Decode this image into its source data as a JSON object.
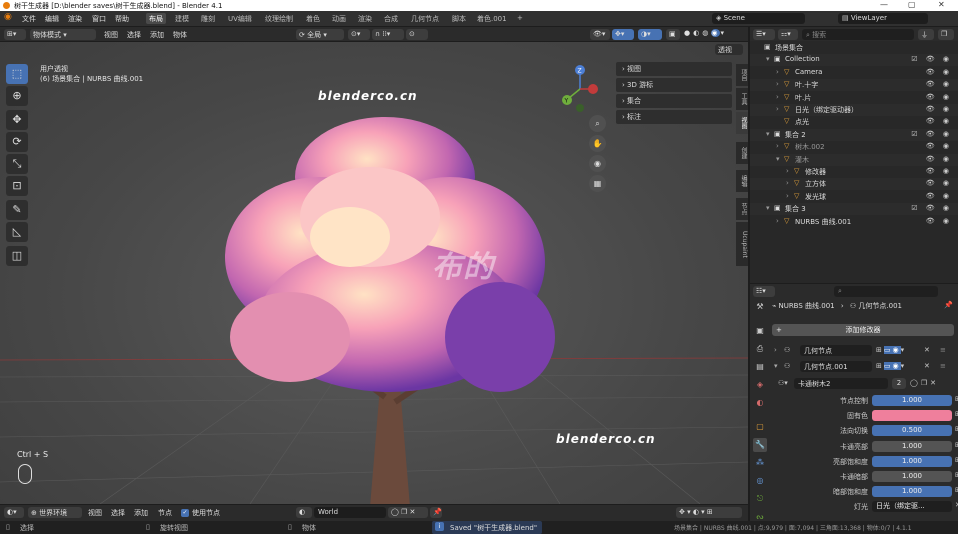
{
  "titlebar": {
    "title": "树干生成器 [D:\\blender saves\\树干生成器.blend] - Blender 4.1"
  },
  "menu": [
    "文件",
    "编辑",
    "渲染",
    "窗口",
    "帮助"
  ],
  "workspaces": [
    "布局",
    "建模",
    "雕刻",
    "UV编辑",
    "纹理绘制",
    "着色",
    "动画",
    "渲染",
    "合成",
    "几何节点",
    "脚本",
    "着色.001"
  ],
  "active_workspace": "布局",
  "scene": {
    "label": "Scene",
    "view_layer": "ViewLayer"
  },
  "viewport_header": {
    "mode": "物体模式",
    "menus": [
      "视图",
      "选择",
      "添加",
      "物体"
    ],
    "transform": "全局",
    "xray_label": "透视"
  },
  "viewport": {
    "overlay_text_1": "用户透视",
    "overlay_text_2": "(6) 场景集合 | NURBS 曲线.001",
    "watermark_1": "blenderco.cn",
    "watermark_2": "blenderco.cn",
    "watermark_3": "布的",
    "shortcut": "Ctrl + S",
    "npanels": [
      "视图",
      "3D 游标",
      "集合",
      "标注"
    ],
    "side_tabs": [
      "项目",
      "工具",
      "视图",
      "创建",
      "编辑",
      "节点",
      "Ucupaint"
    ]
  },
  "outliner": {
    "search_placeholder": "搜索",
    "rows": [
      {
        "label": "场景集合",
        "indent": 0,
        "tri": ""
      },
      {
        "label": "Collection",
        "indent": 1,
        "tri": "▾"
      },
      {
        "label": "Camera",
        "indent": 2,
        "tri": "›"
      },
      {
        "label": "叶.十字",
        "indent": 2,
        "tri": "›"
      },
      {
        "label": "叶.片",
        "indent": 2,
        "tri": "›"
      },
      {
        "label": "日光（绑定驱动器）",
        "indent": 2,
        "tri": "›"
      },
      {
        "label": "点光",
        "indent": 2,
        "tri": ""
      },
      {
        "label": "集合 2",
        "indent": 1,
        "tri": "▾"
      },
      {
        "label": "树木.002",
        "indent": 2,
        "tri": "›"
      },
      {
        "label": "灌木",
        "indent": 2,
        "tri": "▾"
      },
      {
        "label": "修改器",
        "indent": 3,
        "tri": "›"
      },
      {
        "label": "立方体",
        "indent": 3,
        "tri": "›"
      },
      {
        "label": "发光球",
        "indent": 3,
        "tri": "›"
      },
      {
        "label": "集合 3",
        "indent": 1,
        "tri": "▾"
      },
      {
        "label": "NURBS 曲线.001",
        "indent": 2,
        "tri": "›"
      }
    ]
  },
  "properties": {
    "breadcrumb_obj": "NURBS 曲线.001",
    "breadcrumb_mod": "几何节点.001",
    "add_modifier": "添加修改器",
    "modifiers": [
      "几何节点",
      "几何节点.001"
    ],
    "node_group": "卡通树木2",
    "node_group_users": "2",
    "params": [
      {
        "label": "节点控制",
        "value": "1.000",
        "style": "blue"
      },
      {
        "label": "固有色",
        "value": "",
        "style": "pink"
      },
      {
        "label": "法向切换",
        "value": "0.500",
        "style": "blue"
      },
      {
        "label": "卡通亮部",
        "value": "1.000",
        "style": "gray"
      },
      {
        "label": "亮部饱和度",
        "value": "1.000",
        "style": "blue"
      },
      {
        "label": "卡通暗部",
        "value": "1.000",
        "style": "gray"
      },
      {
        "label": "暗部饱和度",
        "value": "1.000",
        "style": "blue"
      },
      {
        "label": "灯光",
        "value": "日光（绑定驱...",
        "style": "field"
      }
    ]
  },
  "timeline": {
    "world_mode": "世界环境",
    "menus": [
      "视图",
      "选择",
      "添加",
      "节点"
    ],
    "use_nodes": "使用节点",
    "world_name": "World"
  },
  "status": {
    "left_1": "选择",
    "left_2": "旋转视图",
    "left_3": "物体",
    "saved": "Saved \"树干生成器.blend\"",
    "stats": "场景集合 | NURBS 曲线.001 | 点:9,979 | 面:7,094 | 三角面:13,368 | 物体:0/7 | 4.1.1"
  },
  "colors": {
    "accent": "#4772b3",
    "pink_swatch": "#ef7f9c",
    "orange": "#e87d0d"
  }
}
